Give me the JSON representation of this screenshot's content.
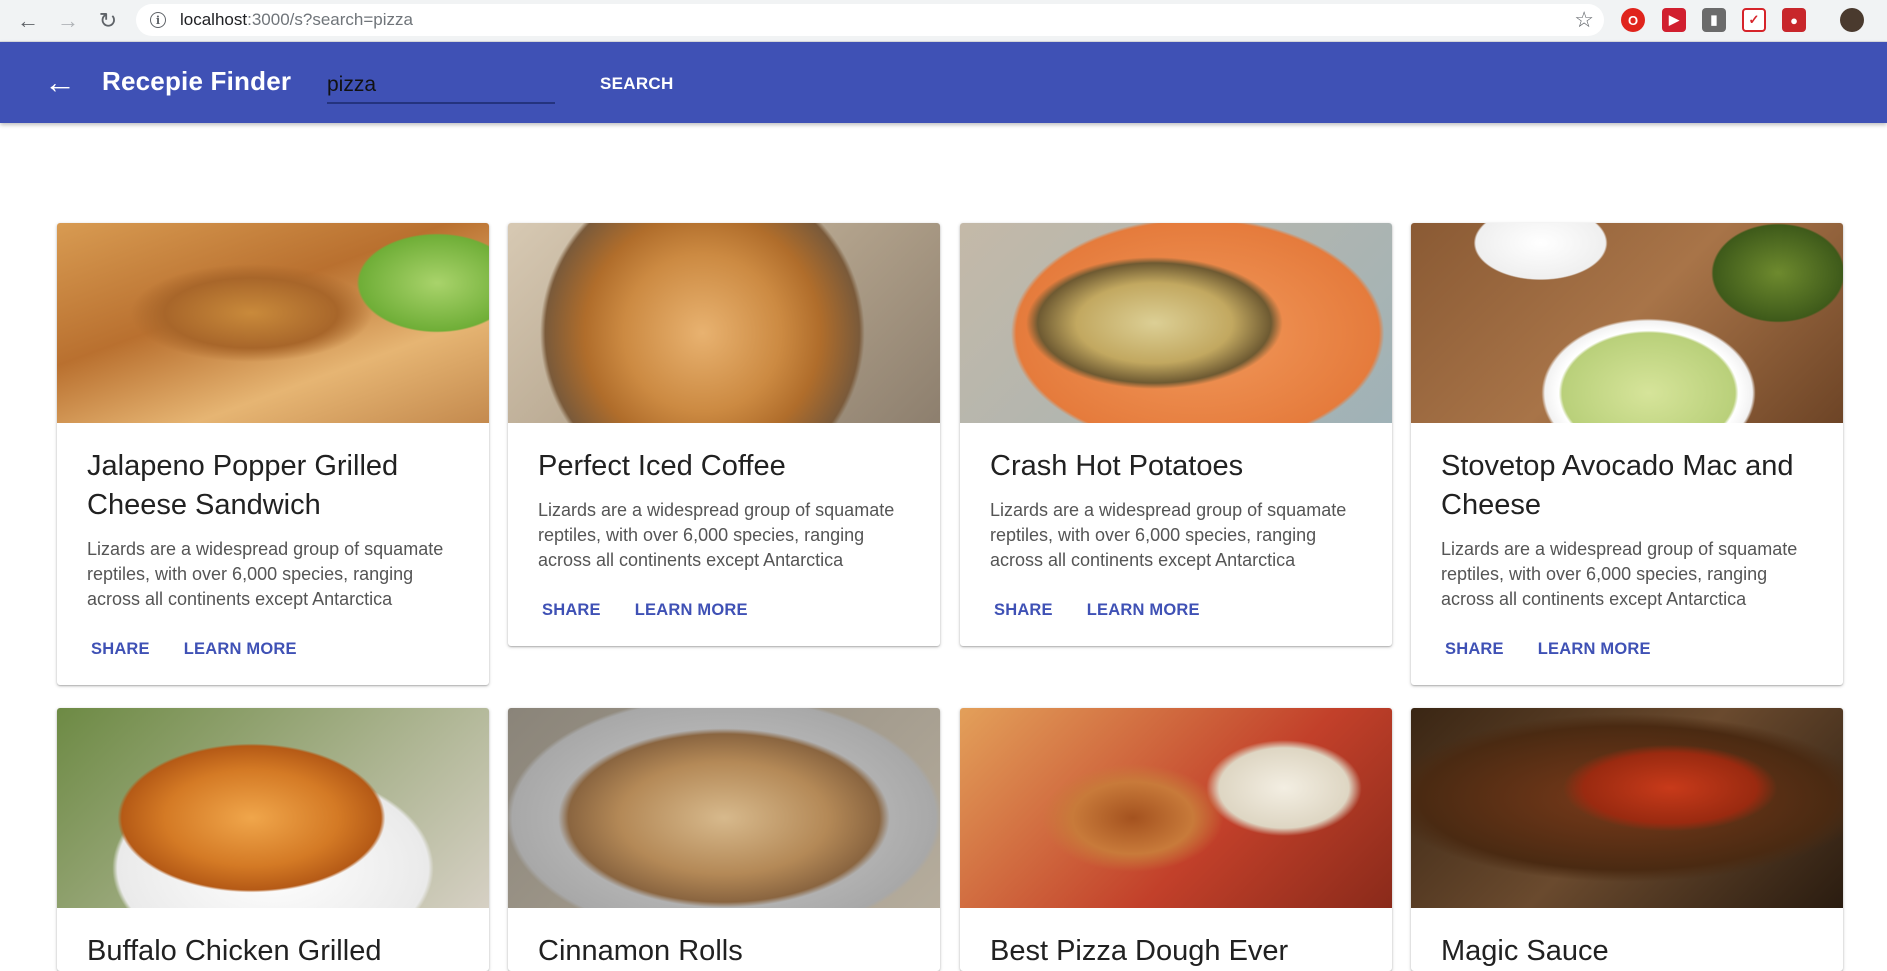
{
  "browser": {
    "url_host": "localhost",
    "url_path": ":3000/s?search=pizza"
  },
  "app_bar": {
    "title": "Recepie Finder",
    "search_value": "pizza",
    "search_button_label": "SEARCH"
  },
  "cards": [
    {
      "title": "Jalapeno Popper Grilled Cheese Sandwich",
      "description": "Lizards are a widespread group of squamate reptiles, with over 6,000 species, ranging across all continents except Antarctica",
      "share_label": "SHARE",
      "learn_more_label": "LEARN MORE"
    },
    {
      "title": "Perfect Iced Coffee",
      "description": "Lizards are a widespread group of squamate reptiles, with over 6,000 species, ranging across all continents except Antarctica",
      "share_label": "SHARE",
      "learn_more_label": "LEARN MORE"
    },
    {
      "title": "Crash Hot Potatoes",
      "description": "Lizards are a widespread group of squamate reptiles, with over 6,000 species, ranging across all continents except Antarctica",
      "share_label": "SHARE",
      "learn_more_label": "LEARN MORE"
    },
    {
      "title": "Stovetop Avocado Mac and Cheese",
      "description": "Lizards are a widespread group of squamate reptiles, with over 6,000 species, ranging across all continents except Antarctica",
      "share_label": "SHARE",
      "learn_more_label": "LEARN MORE"
    },
    {
      "title": "Buffalo Chicken Grilled"
    },
    {
      "title": "Cinnamon Rolls"
    },
    {
      "title": "Best Pizza Dough Ever"
    },
    {
      "title": "Magic Sauce"
    }
  ],
  "colors": {
    "app_bar": "#3f51b5",
    "accent": "#3f51b5"
  },
  "icons": {
    "back": "arrow-left-icon",
    "browser_back": "browser-back-icon",
    "browser_forward": "browser-forward-icon",
    "reload": "reload-icon",
    "info": "info-icon",
    "bookmark": "star-icon"
  }
}
